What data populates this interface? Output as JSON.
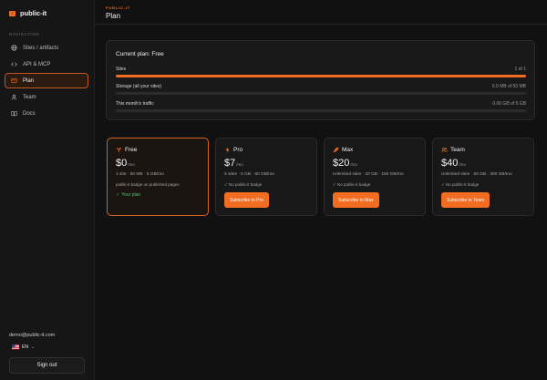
{
  "brand": {
    "name": "public-it",
    "logo_letter": "≡"
  },
  "sidebar": {
    "heading": "NAVIGATION",
    "items": [
      {
        "label": "Sites / artifacts",
        "icon": "globe-icon",
        "active": false
      },
      {
        "label": "API & MCP",
        "icon": "code-icon",
        "active": false
      },
      {
        "label": "Plan",
        "icon": "credit-card-icon",
        "active": true
      },
      {
        "label": "Team",
        "icon": "user-icon",
        "active": false
      },
      {
        "label": "Docs",
        "icon": "book-icon",
        "active": false
      }
    ],
    "user_email": "demo@public-it.com",
    "language": "EN",
    "sign_out_label": "Sign out"
  },
  "header": {
    "crumb": "PUBLIC-IT",
    "title": "Plan"
  },
  "usage": {
    "title": "Current plan: Free",
    "meters": [
      {
        "label": "Sites",
        "value_text": "1 of 1",
        "fraction": 1.0
      },
      {
        "label": "Storage (all your sites)",
        "value_text": "0.0 MB of 50 MB",
        "fraction": 0.0
      },
      {
        "label": "This month's traffic",
        "value_text": "0.00 GB of 5 GB",
        "fraction": 0.0
      }
    ]
  },
  "plans": [
    {
      "name": "Free",
      "icon": "sprout-icon",
      "price": "$0",
      "unit": "/mo",
      "limits": "1 site · 50 MB · 5 GB/mo",
      "note": "public-it badge on published pages",
      "status": "Your plan",
      "check": "✓",
      "current": true,
      "cta": ""
    },
    {
      "name": "Pro",
      "icon": "bolt-icon",
      "price": "$7",
      "unit": "/mo",
      "limits": "5 sites · 5 GB · 50 GB/mo",
      "note": "✓ No public-it badge",
      "status": "",
      "check": "",
      "current": false,
      "cta": "Subscribe to Pro"
    },
    {
      "name": "Max",
      "icon": "rocket-icon",
      "price": "$20",
      "unit": "/mo",
      "limits": "Unlimited sites · 20 GB · 150 GB/mo",
      "note": "✓ No public-it badge",
      "status": "",
      "check": "",
      "current": false,
      "cta": "Subscribe to Max"
    },
    {
      "name": "Team",
      "icon": "users-icon",
      "price": "$40",
      "unit": "/mo",
      "limits": "Unlimited sites · 50 GB · 300 GB/mo",
      "note": "✓ No public-it badge",
      "status": "",
      "check": "",
      "current": false,
      "cta": "Subscribe to Team"
    }
  ],
  "colors": {
    "accent": "#f26d21",
    "background": "#111111",
    "success": "#4cc26d"
  }
}
